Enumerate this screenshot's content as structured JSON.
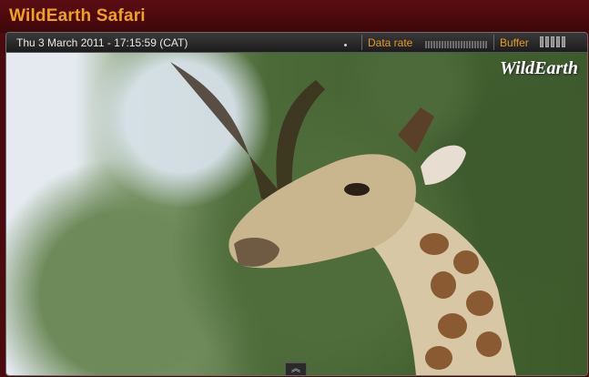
{
  "window": {
    "title": "WildEarth Safari"
  },
  "status": {
    "datetime": "Thu 3 March 2011 - 17:15:59 (CAT)",
    "data_rate_label": "Data rate",
    "buffer_label": "Buffer"
  },
  "video": {
    "watermark": "WildEarth"
  },
  "colors": {
    "accent": "#f0a21e",
    "frame": "#4a0a0e",
    "status_label": "#e69b24"
  },
  "icons": {
    "expand_toggle": "double-chevron-up-icon"
  }
}
